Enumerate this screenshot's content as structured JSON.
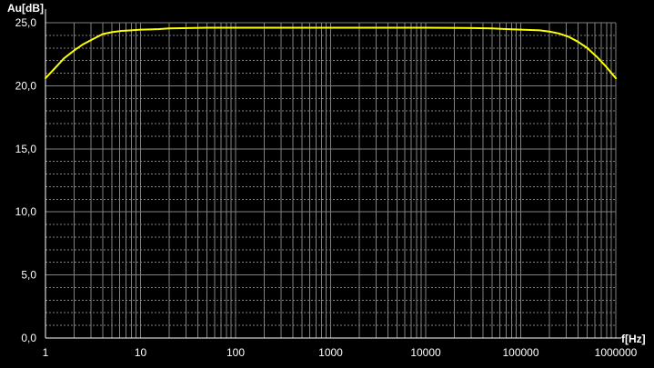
{
  "chart_data": {
    "type": "line",
    "title": "",
    "xlabel": "f[Hz]",
    "ylabel": "Au[dB]",
    "x_scale": "log",
    "xlim": [
      1,
      1000000
    ],
    "ylim": [
      0,
      25
    ],
    "grid": true,
    "x_ticks": [
      "1",
      "10",
      "100",
      "1000",
      "10000",
      "100000",
      "1000000"
    ],
    "y_ticks": [
      "0,0",
      "5,0",
      "10,0",
      "15,0",
      "20,0",
      "25,0"
    ],
    "series": [
      {
        "color": "#ffff00",
        "x": [
          1,
          1.26,
          1.58,
          2,
          2.5,
          3.16,
          4,
          5,
          6.3,
          8,
          10,
          12.6,
          15.8,
          20,
          31.6,
          50,
          100,
          1000,
          10000,
          31623,
          50000,
          70000,
          100000,
          158489,
          200000,
          251189,
          316228,
          398107,
          500000,
          630957,
          794328,
          1000000
        ],
        "values": [
          20.6,
          21.4,
          22.2,
          22.8,
          23.3,
          23.7,
          24.1,
          24.25,
          24.35,
          24.4,
          24.45,
          24.47,
          24.5,
          24.55,
          24.58,
          24.6,
          24.6,
          24.6,
          24.6,
          24.58,
          24.55,
          24.5,
          24.45,
          24.4,
          24.3,
          24.15,
          23.9,
          23.5,
          23.0,
          22.3,
          21.5,
          20.6
        ]
      }
    ]
  },
  "colors": {
    "background": "#000000",
    "grid": "#808080",
    "text": "#ffffff",
    "curve": "#ffff00"
  }
}
